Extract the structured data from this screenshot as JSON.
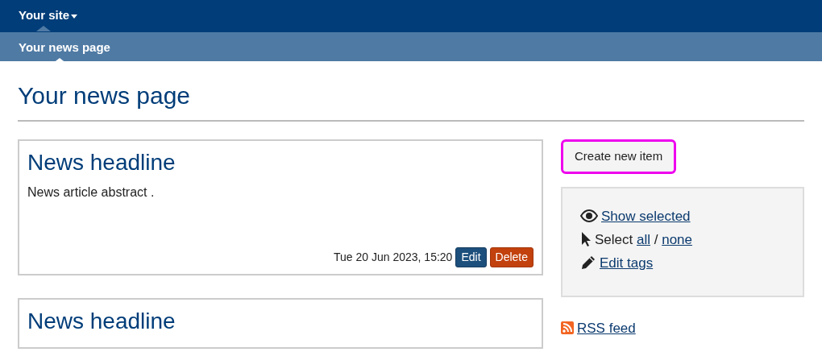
{
  "topbar": {
    "site_menu": "Your site"
  },
  "subbar": {
    "current_page": "Your news page"
  },
  "page_title": "Your news page",
  "articles": [
    {
      "headline": "News headline",
      "abstract": "News article abstract .",
      "date": "Tue 20 Jun 2023, 15:20",
      "buttons": [
        "Edit",
        "Delete"
      ]
    },
    {
      "headline": "News headline"
    }
  ],
  "sidebar": {
    "create_button": {
      "label": "Create new item",
      "highlighted": true
    },
    "actions": [
      {
        "kind": "show",
        "link": "Show selected"
      },
      {
        "kind": "select",
        "text": "Select",
        "link_all": "all",
        "separator": "/",
        "link_none": "none"
      },
      {
        "kind": "tags",
        "link": "Edit tags"
      }
    ],
    "rss": "RSS feed"
  }
}
